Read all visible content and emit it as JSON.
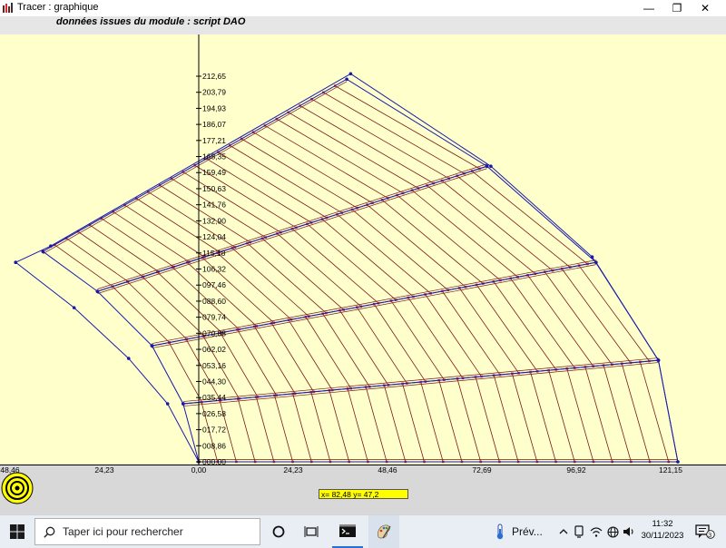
{
  "window": {
    "title": "Tracer : graphique",
    "subtitle": "données issues du module : script DAO",
    "minimize_glyph": "—",
    "restore_glyph": "❐",
    "close_glyph": "✕"
  },
  "chart_data": {
    "type": "line",
    "title": "",
    "xlabel": "",
    "ylabel": "",
    "xlim": [
      -50,
      130
    ],
    "ylim": [
      0,
      216
    ],
    "x_ticks": [
      "48,46",
      "24,23",
      "0,00",
      "24,23",
      "48,46",
      "72,69",
      "96,92",
      "121,15"
    ],
    "x_tick_values": [
      -48.46,
      -24.23,
      0,
      24.23,
      48.46,
      72.69,
      96.92,
      121.15
    ],
    "y_ticks": [
      "000,00",
      "008,86",
      "017,72",
      "026,58",
      "035,44",
      "044,30",
      "053,16",
      "062,02",
      "070,88",
      "079,74",
      "088,60",
      "097,46",
      "106,32",
      "115,18",
      "124,04",
      "132,90",
      "141,76",
      "150,63",
      "159,49",
      "168,35",
      "177,21",
      "186,07",
      "194,93",
      "203,79",
      "212,65"
    ],
    "y_tick_values": [
      0,
      8.86,
      17.72,
      26.58,
      35.44,
      44.3,
      53.16,
      62.02,
      70.88,
      79.74,
      88.6,
      97.46,
      106.32,
      115.18,
      124.04,
      132.9,
      141.76,
      150.63,
      159.49,
      168.35,
      177.21,
      186.07,
      194.93,
      203.79,
      212.65
    ],
    "series": [
      {
        "role": "outline",
        "color": "#1a1aa8",
        "points": [
          [
            -47,
            110
          ],
          [
            -38,
            119
          ],
          [
            39,
            214
          ],
          [
            75,
            163
          ],
          [
            101,
            113
          ],
          [
            118,
            56
          ],
          [
            123,
            0
          ],
          [
            0,
            0
          ],
          [
            -8,
            32
          ],
          [
            -18,
            57
          ],
          [
            -32,
            85
          ],
          [
            -47,
            110
          ]
        ]
      },
      {
        "role": "band-1",
        "color": "#1a1aa8",
        "points": [
          [
            -40,
            116
          ],
          [
            38,
            211
          ],
          [
            74,
            163
          ],
          [
            -26,
            94
          ],
          [
            -40,
            116
          ]
        ]
      },
      {
        "role": "band-2",
        "color": "#1a1aa8",
        "points": [
          [
            -26,
            94
          ],
          [
            74,
            163
          ],
          [
            102,
            110
          ],
          [
            -12,
            64
          ],
          [
            -26,
            94
          ]
        ]
      },
      {
        "role": "band-3",
        "color": "#1a1aa8",
        "points": [
          [
            -12,
            64
          ],
          [
            102,
            110
          ],
          [
            118,
            56
          ],
          [
            -4,
            32
          ],
          [
            -12,
            64
          ]
        ]
      },
      {
        "role": "band-4",
        "color": "#1a1aa8",
        "points": [
          [
            -4,
            32
          ],
          [
            118,
            56
          ],
          [
            123,
            0
          ],
          [
            0,
            0
          ],
          [
            -4,
            32
          ]
        ]
      }
    ],
    "marker_color": "#c83232",
    "rafter_color": "#7a1a1a",
    "background": "#ffffcc",
    "grid": false
  },
  "footer": {
    "coordinates_readout": "x= 82,48  y= 47,2"
  },
  "taskbar": {
    "search_placeholder": "Taper ici pour rechercher",
    "weather_label": "Prév...",
    "time": "11:32",
    "date": "30/11/2023",
    "notification_count": "3"
  },
  "icons": [
    "windows-start-icon",
    "search-icon",
    "cortana-icon",
    "task-view-icon",
    "terminal-icon",
    "paint-icon",
    "weather-icon",
    "chevron-up-icon",
    "network-icon",
    "volume-icon",
    "language-icon",
    "notification-icon",
    "target-icon"
  ]
}
